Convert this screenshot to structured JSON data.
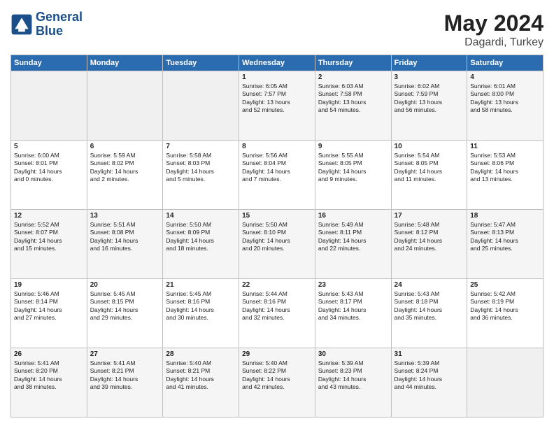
{
  "header": {
    "logo_line1": "General",
    "logo_line2": "Blue",
    "month": "May 2024",
    "location": "Dagardi, Turkey"
  },
  "days_of_week": [
    "Sunday",
    "Monday",
    "Tuesday",
    "Wednesday",
    "Thursday",
    "Friday",
    "Saturday"
  ],
  "weeks": [
    [
      {
        "num": "",
        "info": ""
      },
      {
        "num": "",
        "info": ""
      },
      {
        "num": "",
        "info": ""
      },
      {
        "num": "1",
        "info": "Sunrise: 6:05 AM\nSunset: 7:57 PM\nDaylight: 13 hours\nand 52 minutes."
      },
      {
        "num": "2",
        "info": "Sunrise: 6:03 AM\nSunset: 7:58 PM\nDaylight: 13 hours\nand 54 minutes."
      },
      {
        "num": "3",
        "info": "Sunrise: 6:02 AM\nSunset: 7:59 PM\nDaylight: 13 hours\nand 56 minutes."
      },
      {
        "num": "4",
        "info": "Sunrise: 6:01 AM\nSunset: 8:00 PM\nDaylight: 13 hours\nand 58 minutes."
      }
    ],
    [
      {
        "num": "5",
        "info": "Sunrise: 6:00 AM\nSunset: 8:01 PM\nDaylight: 14 hours\nand 0 minutes."
      },
      {
        "num": "6",
        "info": "Sunrise: 5:59 AM\nSunset: 8:02 PM\nDaylight: 14 hours\nand 2 minutes."
      },
      {
        "num": "7",
        "info": "Sunrise: 5:58 AM\nSunset: 8:03 PM\nDaylight: 14 hours\nand 5 minutes."
      },
      {
        "num": "8",
        "info": "Sunrise: 5:56 AM\nSunset: 8:04 PM\nDaylight: 14 hours\nand 7 minutes."
      },
      {
        "num": "9",
        "info": "Sunrise: 5:55 AM\nSunset: 8:05 PM\nDaylight: 14 hours\nand 9 minutes."
      },
      {
        "num": "10",
        "info": "Sunrise: 5:54 AM\nSunset: 8:05 PM\nDaylight: 14 hours\nand 11 minutes."
      },
      {
        "num": "11",
        "info": "Sunrise: 5:53 AM\nSunset: 8:06 PM\nDaylight: 14 hours\nand 13 minutes."
      }
    ],
    [
      {
        "num": "12",
        "info": "Sunrise: 5:52 AM\nSunset: 8:07 PM\nDaylight: 14 hours\nand 15 minutes."
      },
      {
        "num": "13",
        "info": "Sunrise: 5:51 AM\nSunset: 8:08 PM\nDaylight: 14 hours\nand 16 minutes."
      },
      {
        "num": "14",
        "info": "Sunrise: 5:50 AM\nSunset: 8:09 PM\nDaylight: 14 hours\nand 18 minutes."
      },
      {
        "num": "15",
        "info": "Sunrise: 5:50 AM\nSunset: 8:10 PM\nDaylight: 14 hours\nand 20 minutes."
      },
      {
        "num": "16",
        "info": "Sunrise: 5:49 AM\nSunset: 8:11 PM\nDaylight: 14 hours\nand 22 minutes."
      },
      {
        "num": "17",
        "info": "Sunrise: 5:48 AM\nSunset: 8:12 PM\nDaylight: 14 hours\nand 24 minutes."
      },
      {
        "num": "18",
        "info": "Sunrise: 5:47 AM\nSunset: 8:13 PM\nDaylight: 14 hours\nand 25 minutes."
      }
    ],
    [
      {
        "num": "19",
        "info": "Sunrise: 5:46 AM\nSunset: 8:14 PM\nDaylight: 14 hours\nand 27 minutes."
      },
      {
        "num": "20",
        "info": "Sunrise: 5:45 AM\nSunset: 8:15 PM\nDaylight: 14 hours\nand 29 minutes."
      },
      {
        "num": "21",
        "info": "Sunrise: 5:45 AM\nSunset: 8:16 PM\nDaylight: 14 hours\nand 30 minutes."
      },
      {
        "num": "22",
        "info": "Sunrise: 5:44 AM\nSunset: 8:16 PM\nDaylight: 14 hours\nand 32 minutes."
      },
      {
        "num": "23",
        "info": "Sunrise: 5:43 AM\nSunset: 8:17 PM\nDaylight: 14 hours\nand 34 minutes."
      },
      {
        "num": "24",
        "info": "Sunrise: 5:43 AM\nSunset: 8:18 PM\nDaylight: 14 hours\nand 35 minutes."
      },
      {
        "num": "25",
        "info": "Sunrise: 5:42 AM\nSunset: 8:19 PM\nDaylight: 14 hours\nand 36 minutes."
      }
    ],
    [
      {
        "num": "26",
        "info": "Sunrise: 5:41 AM\nSunset: 8:20 PM\nDaylight: 14 hours\nand 38 minutes."
      },
      {
        "num": "27",
        "info": "Sunrise: 5:41 AM\nSunset: 8:21 PM\nDaylight: 14 hours\nand 39 minutes."
      },
      {
        "num": "28",
        "info": "Sunrise: 5:40 AM\nSunset: 8:21 PM\nDaylight: 14 hours\nand 41 minutes."
      },
      {
        "num": "29",
        "info": "Sunrise: 5:40 AM\nSunset: 8:22 PM\nDaylight: 14 hours\nand 42 minutes."
      },
      {
        "num": "30",
        "info": "Sunrise: 5:39 AM\nSunset: 8:23 PM\nDaylight: 14 hours\nand 43 minutes."
      },
      {
        "num": "31",
        "info": "Sunrise: 5:39 AM\nSunset: 8:24 PM\nDaylight: 14 hours\nand 44 minutes."
      },
      {
        "num": "",
        "info": ""
      }
    ]
  ]
}
